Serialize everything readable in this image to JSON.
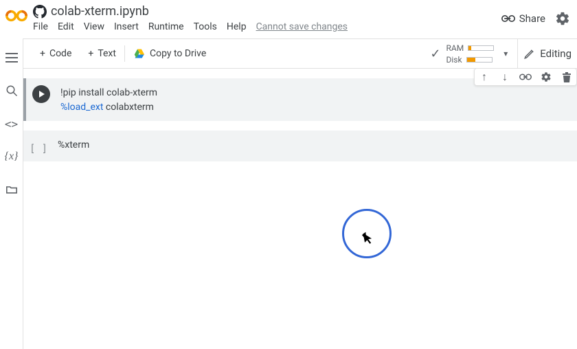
{
  "header": {
    "filename": "colab-xterm.ipynb",
    "menus": [
      "File",
      "Edit",
      "View",
      "Insert",
      "Runtime",
      "Tools",
      "Help"
    ],
    "cannot_save": "Cannot save changes",
    "share_label": "Share"
  },
  "toolbar": {
    "code_label": "Code",
    "text_label": "Text",
    "copy_label": "Copy to Drive",
    "editing_label": "Editing",
    "status": {
      "ram_label": "RAM",
      "disk_label": "Disk"
    }
  },
  "cells": {
    "c1": {
      "line1_a": "!pip install colab-xterm",
      "line2_magic": "%load_ext",
      "line2_rest": " colabxterm"
    },
    "c2": {
      "bracket": "[ ]",
      "line1": "%xterm"
    }
  }
}
